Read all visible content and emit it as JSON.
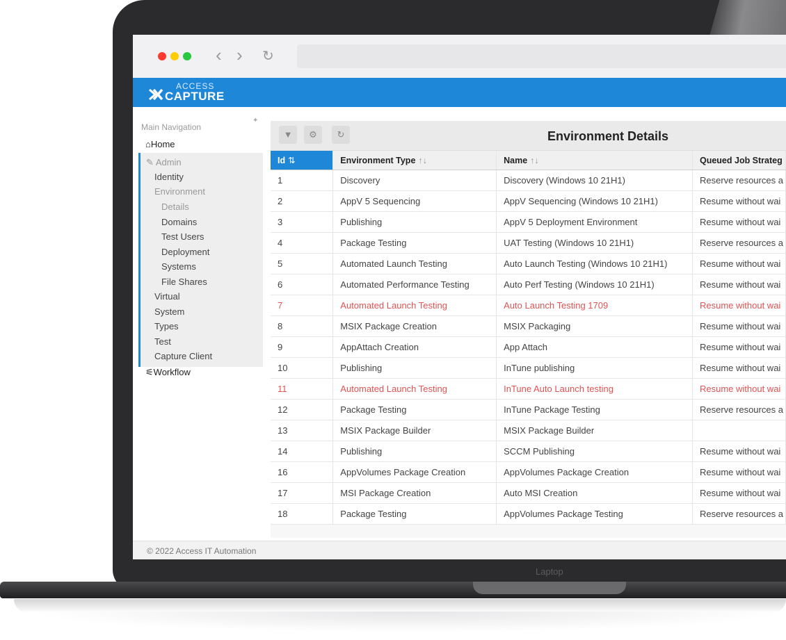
{
  "device": {
    "label": "Laptop"
  },
  "app": {
    "logo_small": "ACCESS",
    "logo_big": "CAPTURE",
    "footer": "© 2022 Access IT Automation"
  },
  "sidebar": {
    "title": "Main Navigation",
    "home": "Home",
    "admin": "Admin",
    "items": [
      "Identity",
      "Environment",
      "Details",
      "Domains",
      "Test Users",
      "Deployment",
      "Systems",
      "File Shares",
      "Virtual",
      "System",
      "Types",
      "Test",
      "Capture Client"
    ],
    "workflow": "Workflow"
  },
  "panel": {
    "title": "Environment Details",
    "columns": [
      "Id",
      "Environment Type",
      "Name",
      "Queued Job Strateg"
    ],
    "sort_icons": {
      "id": "⇅",
      "type": "↑↓",
      "name": "↑↓"
    },
    "rows": [
      {
        "id": "1",
        "type": "Discovery",
        "name": "Discovery (Windows 10 21H1)",
        "strategy": "Reserve resources a",
        "highlight": false
      },
      {
        "id": "2",
        "type": "AppV 5 Sequencing",
        "name": "AppV Sequencing (Windows 10 21H1)",
        "strategy": "Resume without wai",
        "highlight": false
      },
      {
        "id": "3",
        "type": "Publishing",
        "name": "AppV 5 Deployment Environment",
        "strategy": "Resume without wai",
        "highlight": false
      },
      {
        "id": "4",
        "type": "Package Testing",
        "name": "UAT Testing (Windows 10 21H1)",
        "strategy": "Reserve resources a",
        "highlight": false
      },
      {
        "id": "5",
        "type": "Automated Launch Testing",
        "name": "Auto Launch Testing (Windows 10 21H1)",
        "strategy": "Resume without wai",
        "highlight": false
      },
      {
        "id": "6",
        "type": "Automated Performance Testing",
        "name": "Auto Perf Testing (Windows 10 21H1)",
        "strategy": "Resume without wai",
        "highlight": false
      },
      {
        "id": "7",
        "type": "Automated Launch Testing",
        "name": "Auto Launch Testing 1709",
        "strategy": "Resume without wai",
        "highlight": true
      },
      {
        "id": "8",
        "type": "MSIX Package Creation",
        "name": "MSIX Packaging",
        "strategy": "Resume without wai",
        "highlight": false
      },
      {
        "id": "9",
        "type": "AppAttach Creation",
        "name": "App Attach",
        "strategy": "Resume without wai",
        "highlight": false
      },
      {
        "id": "10",
        "type": "Publishing",
        "name": "InTune publishing",
        "strategy": "Resume without wai",
        "highlight": false
      },
      {
        "id": "11",
        "type": "Automated Launch Testing",
        "name": "InTune Auto Launch testing",
        "strategy": "Resume without wai",
        "highlight": true
      },
      {
        "id": "12",
        "type": "Package Testing",
        "name": "InTune Package Testing",
        "strategy": "Reserve resources a",
        "highlight": false
      },
      {
        "id": "13",
        "type": "MSIX Package Builder",
        "name": "MSIX Package Builder",
        "strategy": "",
        "highlight": false
      },
      {
        "id": "14",
        "type": "Publishing",
        "name": "SCCM Publishing",
        "strategy": "Resume without wai",
        "highlight": false
      },
      {
        "id": "16",
        "type": "AppVolumes Package Creation",
        "name": "AppVolumes Package Creation",
        "strategy": "Resume without wai",
        "highlight": false
      },
      {
        "id": "17",
        "type": "MSI Package Creation",
        "name": "Auto MSI Creation",
        "strategy": "Resume without wai",
        "highlight": false
      },
      {
        "id": "18",
        "type": "Package Testing",
        "name": "AppVolumes Package Testing",
        "strategy": "Reserve resources a",
        "highlight": false
      }
    ]
  },
  "colors": {
    "accent": "#1f87d8",
    "highlight_text": "#e05252"
  }
}
